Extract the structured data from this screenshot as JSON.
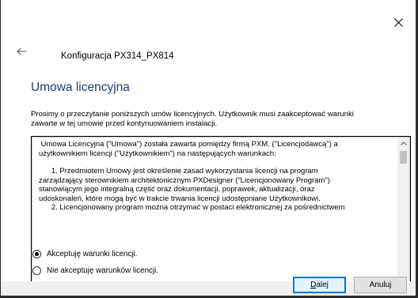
{
  "header": {
    "title": "Konfiguracja PX314_PX814"
  },
  "section": {
    "title": "Umowa licencyjna",
    "intro_line1": "Prosimy o przeczytanie poniższych umów licencyjnych. Użytkownik musi zaakceptować warunki",
    "intro_line2": "zawarte w tej umowie przed kontynuowaniem instalacji."
  },
  "license": {
    "lines": [
      " Umowa Licencyjna (\"Umowa\") została zawarta pomiędzy firmą PXM. (\"Licencjodawcą\") a",
      "użytkownikiem licencji (\"Użytkownikiem\") na następujących warunkach:",
      "",
      "      1. Przedmiotem Umowy jest określenie zasad wykorzystania licencji na program",
      "zarządzający sterownikiem architektonicznym PXDesigner (\"Licencjonowany Program\")",
      "stanowiącym jego integralną część oraz dokumentacji, poprawek, aktualizacji, oraz",
      "udoskonaleń, które mogą być w trakcie trwania licencji udostępniane Użytkownikowi.",
      "      2. Licencjonowany program można otrzymać w postaci elektronicznej za pośrednictwem"
    ]
  },
  "options": {
    "accept_label": "Akceptuję warunki licencji.",
    "decline_label": "Nie akceptuję warunków licencji.",
    "selected": "accept"
  },
  "buttons": {
    "next_mnemonic": "D",
    "next_rest": "alej",
    "cancel_label": "Anuluj"
  },
  "icons": {
    "close": "close-icon",
    "back": "arrow-left-icon"
  },
  "colors": {
    "title_blue": "#1a3e6e",
    "accent": "#0078d7"
  }
}
